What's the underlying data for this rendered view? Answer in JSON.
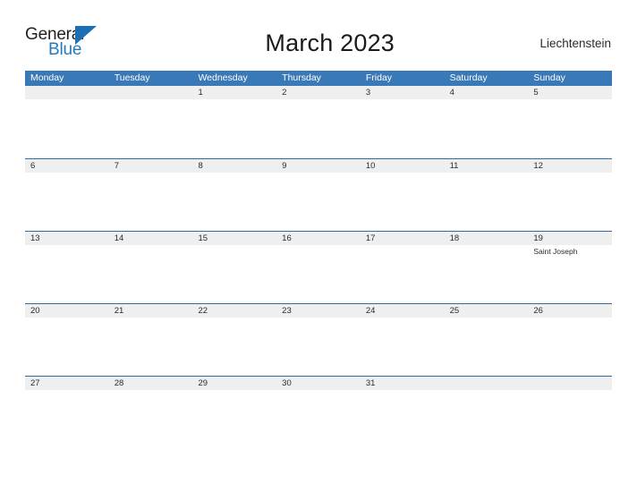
{
  "logo": {
    "word_top": "General",
    "word_bottom": "Blue",
    "triangle_color": "#1b6fb5",
    "blue_color": "#1f7ac0"
  },
  "header": {
    "title": "March 2023",
    "country": "Liechtenstein"
  },
  "colors": {
    "header_blue": "#3a79b8",
    "row_line_blue": "#2e6da4",
    "number_strip_gray": "#efefef",
    "text_dark": "#2b2b2b"
  },
  "weekdays": [
    "Monday",
    "Tuesday",
    "Wednesday",
    "Thursday",
    "Friday",
    "Saturday",
    "Sunday"
  ],
  "weeks": [
    {
      "days": [
        {
          "number": "",
          "event": ""
        },
        {
          "number": "",
          "event": ""
        },
        {
          "number": "1",
          "event": ""
        },
        {
          "number": "2",
          "event": ""
        },
        {
          "number": "3",
          "event": ""
        },
        {
          "number": "4",
          "event": ""
        },
        {
          "number": "5",
          "event": ""
        }
      ]
    },
    {
      "days": [
        {
          "number": "6",
          "event": ""
        },
        {
          "number": "7",
          "event": ""
        },
        {
          "number": "8",
          "event": ""
        },
        {
          "number": "9",
          "event": ""
        },
        {
          "number": "10",
          "event": ""
        },
        {
          "number": "11",
          "event": ""
        },
        {
          "number": "12",
          "event": ""
        }
      ]
    },
    {
      "days": [
        {
          "number": "13",
          "event": ""
        },
        {
          "number": "14",
          "event": ""
        },
        {
          "number": "15",
          "event": ""
        },
        {
          "number": "16",
          "event": ""
        },
        {
          "number": "17",
          "event": ""
        },
        {
          "number": "18",
          "event": ""
        },
        {
          "number": "19",
          "event": "Saint Joseph"
        }
      ]
    },
    {
      "days": [
        {
          "number": "20",
          "event": ""
        },
        {
          "number": "21",
          "event": ""
        },
        {
          "number": "22",
          "event": ""
        },
        {
          "number": "23",
          "event": ""
        },
        {
          "number": "24",
          "event": ""
        },
        {
          "number": "25",
          "event": ""
        },
        {
          "number": "26",
          "event": ""
        }
      ]
    },
    {
      "days": [
        {
          "number": "27",
          "event": ""
        },
        {
          "number": "28",
          "event": ""
        },
        {
          "number": "29",
          "event": ""
        },
        {
          "number": "30",
          "event": ""
        },
        {
          "number": "31",
          "event": ""
        },
        {
          "number": "",
          "event": ""
        },
        {
          "number": "",
          "event": ""
        }
      ]
    }
  ]
}
